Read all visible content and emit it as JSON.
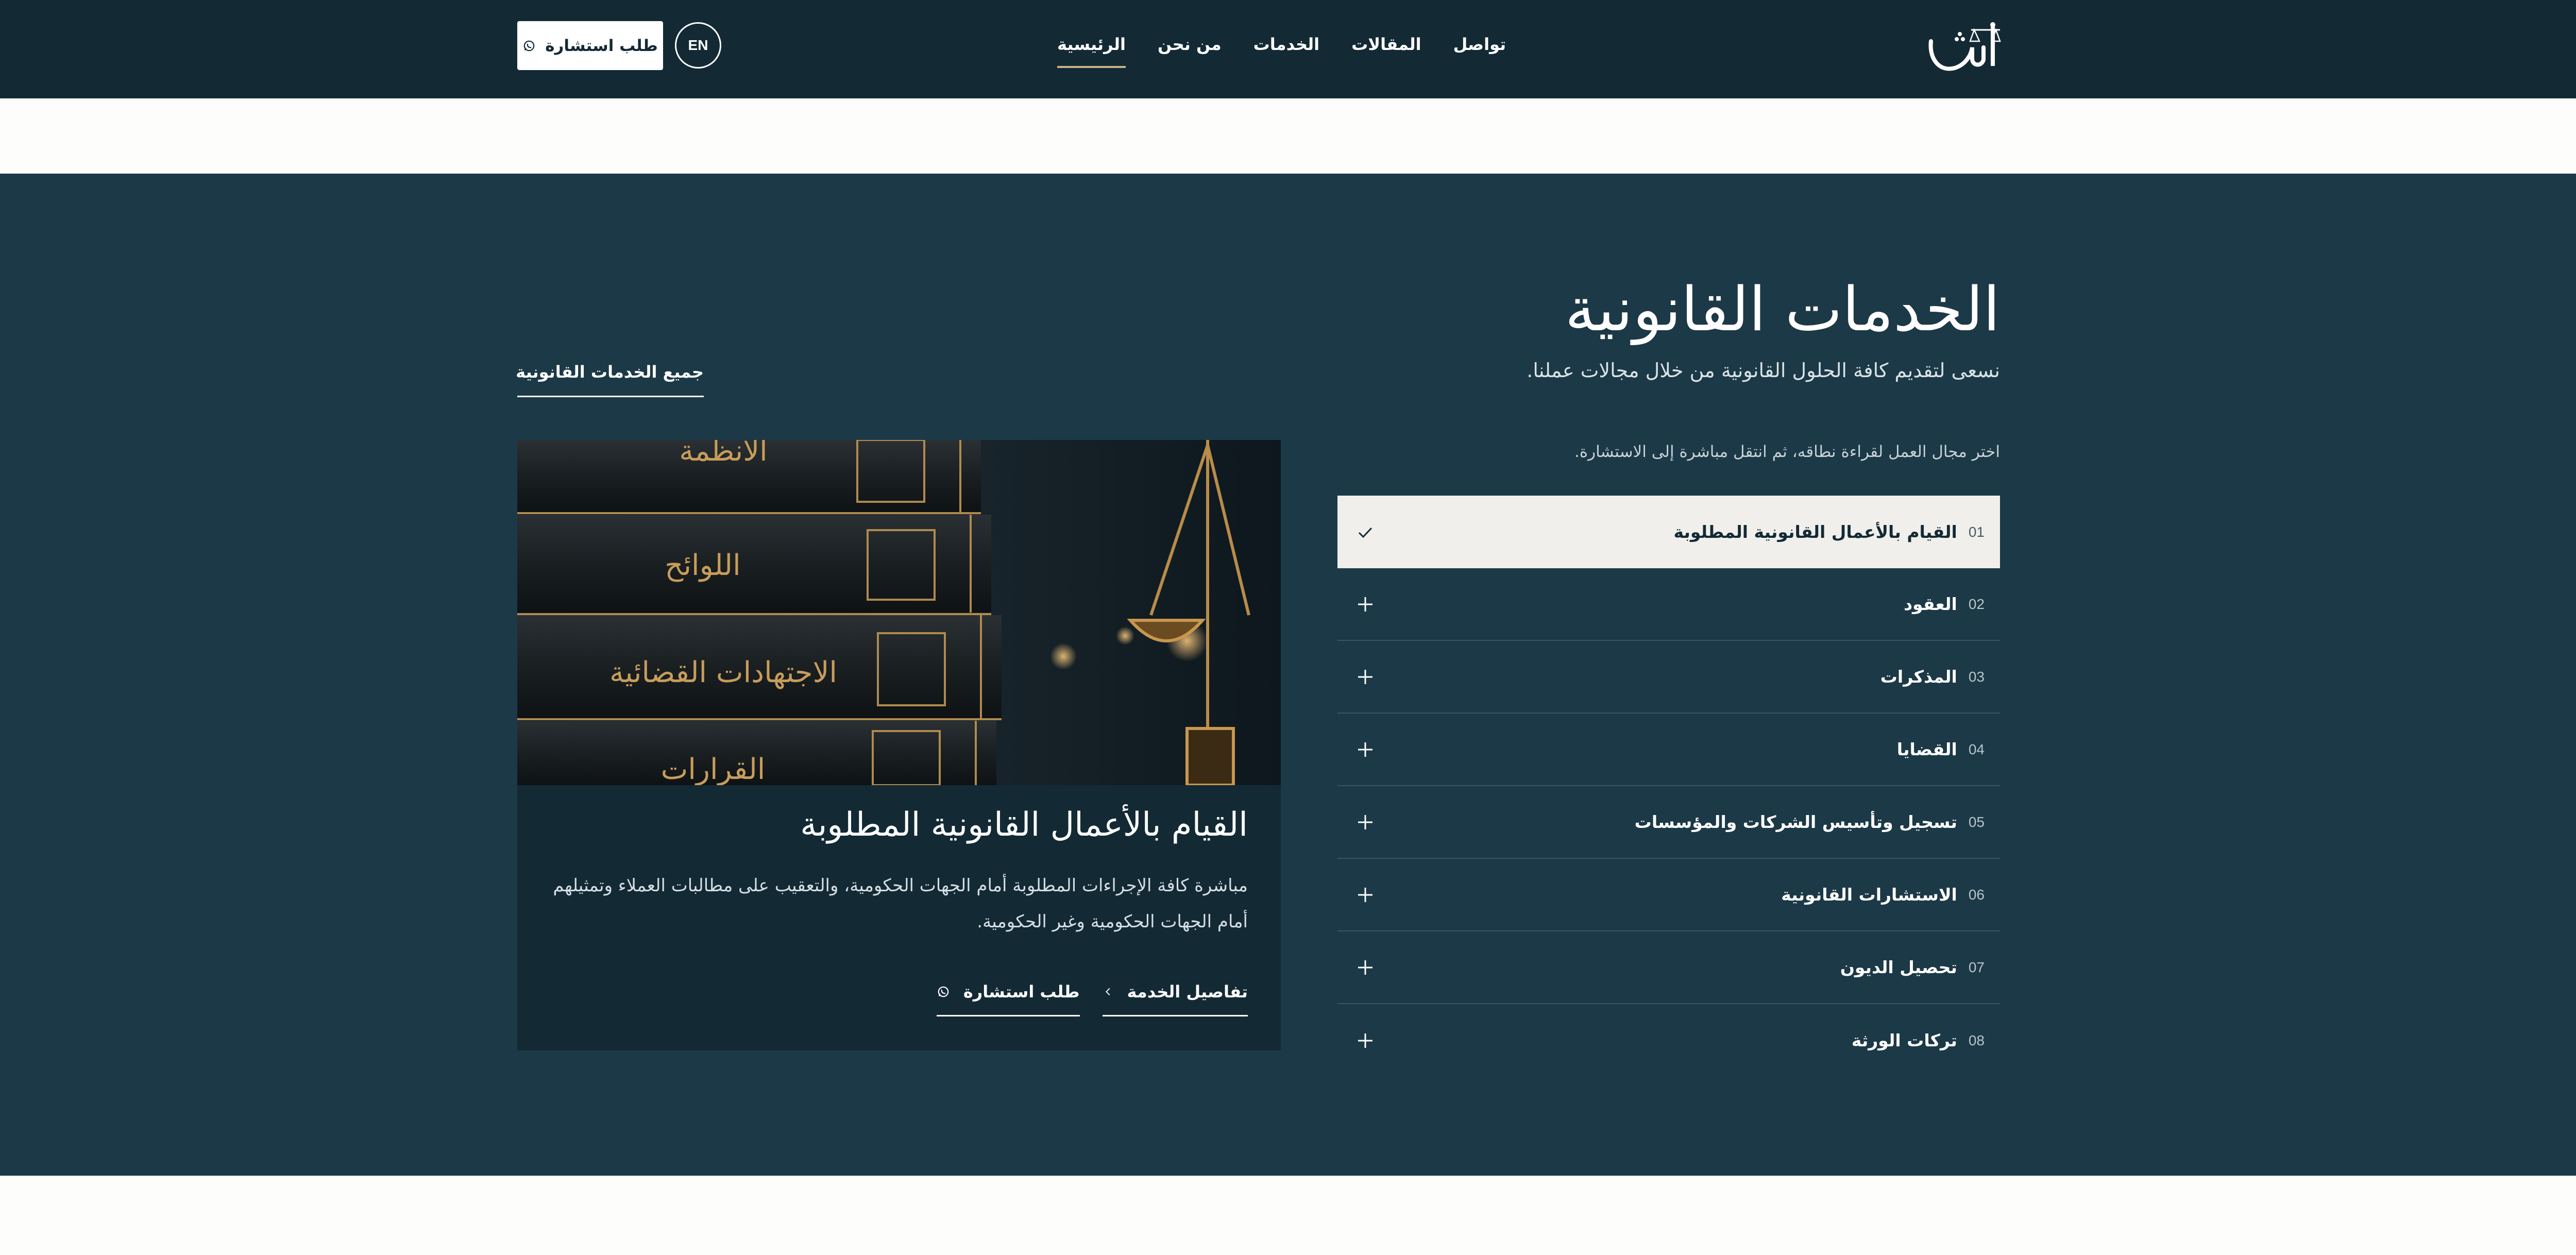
{
  "header": {
    "logo_text": "شا",
    "nav": [
      {
        "label": "الرئيسية",
        "active": true
      },
      {
        "label": "من نحن",
        "active": false
      },
      {
        "label": "الخدمات",
        "active": false
      },
      {
        "label": "المقالات",
        "active": false
      },
      {
        "label": "تواصل",
        "active": false
      }
    ],
    "lang_label": "EN",
    "cta_label": "طلب استشارة"
  },
  "section": {
    "title": "الخدمات القانونية",
    "subtitle": "نسعى لتقديم كافة الحلول القانونية من خلال مجالات عملنا.",
    "all_link": "جميع الخدمات القانونية",
    "hint": "اختر مجال العمل لقراءة نطاقه، ثم انتقل مباشرة إلى الاستشارة."
  },
  "services": [
    {
      "num": "01",
      "label": "القيام بالأعمال القانونية المطلوبة",
      "active": true
    },
    {
      "num": "02",
      "label": "العقود",
      "active": false
    },
    {
      "num": "03",
      "label": "المذكرات",
      "active": false
    },
    {
      "num": "04",
      "label": "القضايا",
      "active": false
    },
    {
      "num": "05",
      "label": "تسجيل وتأسيس الشركات والمؤسسات",
      "active": false
    },
    {
      "num": "06",
      "label": "الاستشارات القانونية",
      "active": false
    },
    {
      "num": "07",
      "label": "تحصيل الديون",
      "active": false
    },
    {
      "num": "08",
      "label": "تركات الورثة",
      "active": false
    }
  ],
  "card": {
    "image_book_titles": [
      "الأنظمة",
      "اللوائح",
      "الاجتهادات القضائية",
      "القرارات"
    ],
    "title": "القيام بالأعمال القانونية المطلوبة",
    "description": "مباشرة كافة الإجراءات المطلوبة أمام الجهات الحكومية، والتعقيب على مطالبات العملاء وتمثيلهم أمام الجهات الحكومية وغير الحكومية.",
    "details_label": "تفاصيل الخدمة",
    "consult_label": "طلب استشارة"
  },
  "colors": {
    "header_bg": "#132a35",
    "section_bg": "#1c3947",
    "accent_gold": "#c9b28a",
    "active_item_bg": "#f0efeb"
  },
  "icons": {
    "cta": "whatsapp-icon",
    "active_toggle": "check-icon",
    "inactive_toggle": "plus-icon",
    "link_arrow": "chevron-left-icon",
    "fab": "whatsapp-icon"
  }
}
